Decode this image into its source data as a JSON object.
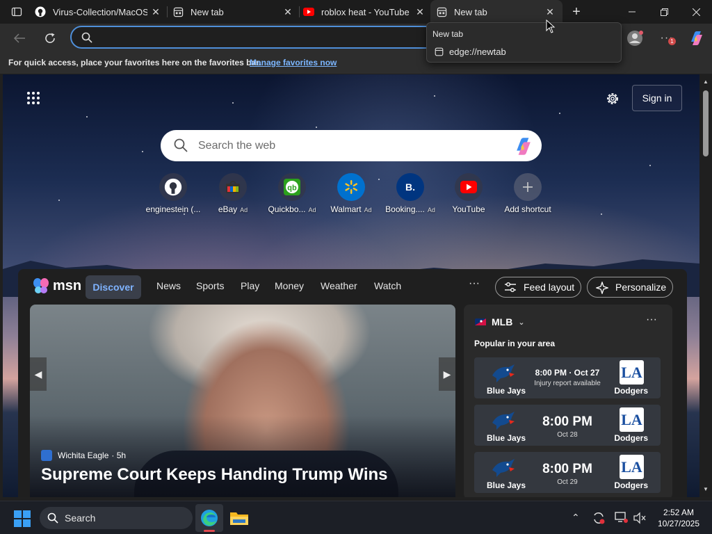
{
  "tabs": [
    {
      "title": "Virus-Collection/MacOS",
      "icon": "github-icon"
    },
    {
      "title": "New tab",
      "icon": "newtab-icon"
    },
    {
      "title": "roblox heat - YouTube",
      "icon": "youtube-icon"
    },
    {
      "title": "New tab",
      "icon": "newtab-icon",
      "active": true
    }
  ],
  "omnibox": {
    "value": "",
    "placeholder": ""
  },
  "favorites_bar": {
    "message": "For quick access, place your favorites here on the favorites bar.",
    "link": "Manage favorites now"
  },
  "popup": {
    "title": "New tab",
    "url": "edge://newtab"
  },
  "newtab": {
    "sign_in": "Sign in",
    "search_placeholder": "Search the web",
    "shortcuts": [
      {
        "label": "enginestein (...",
        "ad": "",
        "icon": "github-icon",
        "color": "#ffffff"
      },
      {
        "label": "eBay",
        "ad": "Ad",
        "icon": "ebay-icon",
        "color": "#e53238"
      },
      {
        "label": "Quickbo...",
        "ad": "Ad",
        "icon": "quickbooks-icon",
        "color": "#2ca01c"
      },
      {
        "label": "Walmart",
        "ad": "Ad",
        "icon": "walmart-icon",
        "color": "#0071ce"
      },
      {
        "label": "Booking....",
        "ad": "Ad",
        "icon": "booking-icon",
        "color": "#003580"
      },
      {
        "label": "YouTube",
        "ad": "",
        "icon": "youtube-icon",
        "color": "#ff0000"
      },
      {
        "label": "Add shortcut",
        "ad": "",
        "icon": "plus-icon",
        "color": "#cccccc"
      }
    ]
  },
  "feed": {
    "brand": "msn",
    "nav": [
      "Discover",
      "News",
      "Sports",
      "Play",
      "Money",
      "Weather",
      "Watch"
    ],
    "feed_layout": "Feed layout",
    "personalize": "Personalize",
    "hero": {
      "source": "Wichita Eagle",
      "age": "· 5h",
      "headline": "Supreme Court Keeps Handing Trump Wins"
    },
    "mlb": {
      "title": "MLB",
      "subtitle": "Popular in your area",
      "games": [
        {
          "home": "Blue Jays",
          "away": "Dodgers",
          "time": "8:00 PM · Oct 27",
          "sub": "Injury report available"
        },
        {
          "home": "Blue Jays",
          "away": "Dodgers",
          "time": "8:00 PM",
          "sub": "Oct 28"
        },
        {
          "home": "Blue Jays",
          "away": "Dodgers",
          "time": "8:00 PM",
          "sub": "Oct 29"
        }
      ]
    }
  },
  "taskbar": {
    "search_label": "Search",
    "time": "2:52 AM",
    "date": "10/27/2025"
  },
  "colors": {
    "accent": "#4f8fd9",
    "link": "#7cb6ff",
    "discover": "#7fb3ff"
  }
}
